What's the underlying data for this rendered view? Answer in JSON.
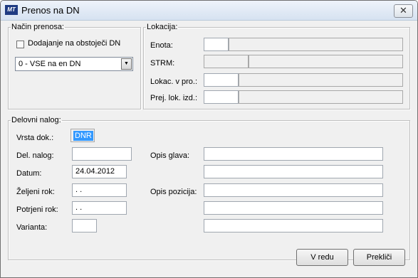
{
  "window": {
    "title": "Prenos na DN",
    "icon_text": "MT",
    "close_glyph": "✕"
  },
  "nacin": {
    "legend": "Način prenosa:",
    "checkbox_label": "Dodajanje na obstoječi DN",
    "checkbox_checked": false,
    "combo_value": "0 - VSE na en DN",
    "combo_arrow": "▼"
  },
  "lokacija": {
    "legend": "Lokacija:",
    "enota_label": "Enota:",
    "strm_label": "STRM:",
    "lokac_label": "Lokac. v pro.:",
    "prej_label": "Prej. lok. izd.:",
    "enota_value": "",
    "strm_value": "",
    "lokac_value": "",
    "prej_value": ""
  },
  "delovni": {
    "legend": "Delovni nalog:",
    "vrsta_label": "Vrsta dok.:",
    "vrsta_value": "DNR",
    "del_nalog_label": "Del. nalog:",
    "del_nalog_value": "",
    "datum_label": "Datum:",
    "datum_value": "24.04.2012",
    "zeljeni_label": "Željeni rok:",
    "zeljeni_value": "  .  .",
    "potrjeni_label": "Potrjeni rok:",
    "potrjeni_value": "  .  .",
    "varianta_label": "Varianta:",
    "varianta_value": "",
    "opis_glava_label": "Opis glava:",
    "opis_pozicija_label": "Opis pozicija:"
  },
  "buttons": {
    "ok_label": "V redu",
    "cancel_label": "Prekliči"
  }
}
